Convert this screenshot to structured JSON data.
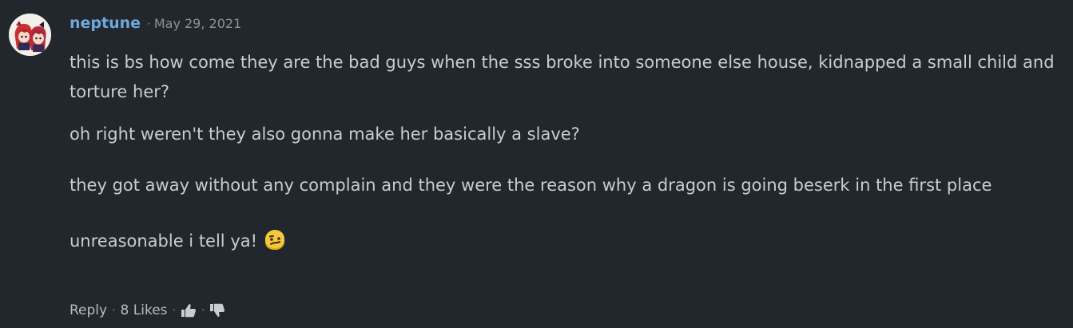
{
  "comment": {
    "username": "neptune",
    "separator": "·",
    "date": "May 29, 2021",
    "paragraphs": [
      "this is bs how come they are the bad guys when the sss broke into someone else house, kidnapped a small child and torture her?",
      "oh right weren't they also gonna make her basically a slave?",
      "they got away without any complain and they were the reason why a dragon is going beserk in the first place",
      "unreasonable i tell ya!"
    ],
    "emoji": "confused-face-emoji"
  },
  "footer": {
    "reply_label": "Reply",
    "separator": "·",
    "likes_label": "8 Likes",
    "like_icon": "thumbs-up-icon",
    "dislike_icon": "thumbs-down-icon"
  },
  "colors": {
    "background": "#22262d",
    "username": "#6fa8dc",
    "text": "#c9ccd0",
    "meta": "#8d9298"
  }
}
